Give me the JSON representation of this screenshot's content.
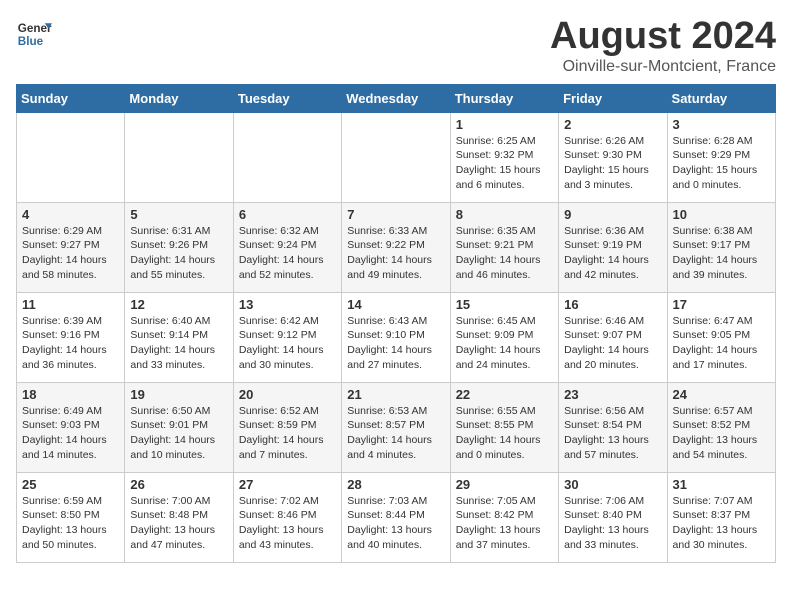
{
  "header": {
    "logo_general": "General",
    "logo_blue": "Blue",
    "title": "August 2024",
    "subtitle": "Oinville-sur-Montcient, France"
  },
  "days_of_week": [
    "Sunday",
    "Monday",
    "Tuesday",
    "Wednesday",
    "Thursday",
    "Friday",
    "Saturday"
  ],
  "weeks": [
    [
      {
        "day": "",
        "detail": ""
      },
      {
        "day": "",
        "detail": ""
      },
      {
        "day": "",
        "detail": ""
      },
      {
        "day": "",
        "detail": ""
      },
      {
        "day": "1",
        "detail": "Sunrise: 6:25 AM\nSunset: 9:32 PM\nDaylight: 15 hours\nand 6 minutes."
      },
      {
        "day": "2",
        "detail": "Sunrise: 6:26 AM\nSunset: 9:30 PM\nDaylight: 15 hours\nand 3 minutes."
      },
      {
        "day": "3",
        "detail": "Sunrise: 6:28 AM\nSunset: 9:29 PM\nDaylight: 15 hours\nand 0 minutes."
      }
    ],
    [
      {
        "day": "4",
        "detail": "Sunrise: 6:29 AM\nSunset: 9:27 PM\nDaylight: 14 hours\nand 58 minutes."
      },
      {
        "day": "5",
        "detail": "Sunrise: 6:31 AM\nSunset: 9:26 PM\nDaylight: 14 hours\nand 55 minutes."
      },
      {
        "day": "6",
        "detail": "Sunrise: 6:32 AM\nSunset: 9:24 PM\nDaylight: 14 hours\nand 52 minutes."
      },
      {
        "day": "7",
        "detail": "Sunrise: 6:33 AM\nSunset: 9:22 PM\nDaylight: 14 hours\nand 49 minutes."
      },
      {
        "day": "8",
        "detail": "Sunrise: 6:35 AM\nSunset: 9:21 PM\nDaylight: 14 hours\nand 46 minutes."
      },
      {
        "day": "9",
        "detail": "Sunrise: 6:36 AM\nSunset: 9:19 PM\nDaylight: 14 hours\nand 42 minutes."
      },
      {
        "day": "10",
        "detail": "Sunrise: 6:38 AM\nSunset: 9:17 PM\nDaylight: 14 hours\nand 39 minutes."
      }
    ],
    [
      {
        "day": "11",
        "detail": "Sunrise: 6:39 AM\nSunset: 9:16 PM\nDaylight: 14 hours\nand 36 minutes."
      },
      {
        "day": "12",
        "detail": "Sunrise: 6:40 AM\nSunset: 9:14 PM\nDaylight: 14 hours\nand 33 minutes."
      },
      {
        "day": "13",
        "detail": "Sunrise: 6:42 AM\nSunset: 9:12 PM\nDaylight: 14 hours\nand 30 minutes."
      },
      {
        "day": "14",
        "detail": "Sunrise: 6:43 AM\nSunset: 9:10 PM\nDaylight: 14 hours\nand 27 minutes."
      },
      {
        "day": "15",
        "detail": "Sunrise: 6:45 AM\nSunset: 9:09 PM\nDaylight: 14 hours\nand 24 minutes."
      },
      {
        "day": "16",
        "detail": "Sunrise: 6:46 AM\nSunset: 9:07 PM\nDaylight: 14 hours\nand 20 minutes."
      },
      {
        "day": "17",
        "detail": "Sunrise: 6:47 AM\nSunset: 9:05 PM\nDaylight: 14 hours\nand 17 minutes."
      }
    ],
    [
      {
        "day": "18",
        "detail": "Sunrise: 6:49 AM\nSunset: 9:03 PM\nDaylight: 14 hours\nand 14 minutes."
      },
      {
        "day": "19",
        "detail": "Sunrise: 6:50 AM\nSunset: 9:01 PM\nDaylight: 14 hours\nand 10 minutes."
      },
      {
        "day": "20",
        "detail": "Sunrise: 6:52 AM\nSunset: 8:59 PM\nDaylight: 14 hours\nand 7 minutes."
      },
      {
        "day": "21",
        "detail": "Sunrise: 6:53 AM\nSunset: 8:57 PM\nDaylight: 14 hours\nand 4 minutes."
      },
      {
        "day": "22",
        "detail": "Sunrise: 6:55 AM\nSunset: 8:55 PM\nDaylight: 14 hours\nand 0 minutes."
      },
      {
        "day": "23",
        "detail": "Sunrise: 6:56 AM\nSunset: 8:54 PM\nDaylight: 13 hours\nand 57 minutes."
      },
      {
        "day": "24",
        "detail": "Sunrise: 6:57 AM\nSunset: 8:52 PM\nDaylight: 13 hours\nand 54 minutes."
      }
    ],
    [
      {
        "day": "25",
        "detail": "Sunrise: 6:59 AM\nSunset: 8:50 PM\nDaylight: 13 hours\nand 50 minutes."
      },
      {
        "day": "26",
        "detail": "Sunrise: 7:00 AM\nSunset: 8:48 PM\nDaylight: 13 hours\nand 47 minutes."
      },
      {
        "day": "27",
        "detail": "Sunrise: 7:02 AM\nSunset: 8:46 PM\nDaylight: 13 hours\nand 43 minutes."
      },
      {
        "day": "28",
        "detail": "Sunrise: 7:03 AM\nSunset: 8:44 PM\nDaylight: 13 hours\nand 40 minutes."
      },
      {
        "day": "29",
        "detail": "Sunrise: 7:05 AM\nSunset: 8:42 PM\nDaylight: 13 hours\nand 37 minutes."
      },
      {
        "day": "30",
        "detail": "Sunrise: 7:06 AM\nSunset: 8:40 PM\nDaylight: 13 hours\nand 33 minutes."
      },
      {
        "day": "31",
        "detail": "Sunrise: 7:07 AM\nSunset: 8:37 PM\nDaylight: 13 hours\nand 30 minutes."
      }
    ]
  ]
}
